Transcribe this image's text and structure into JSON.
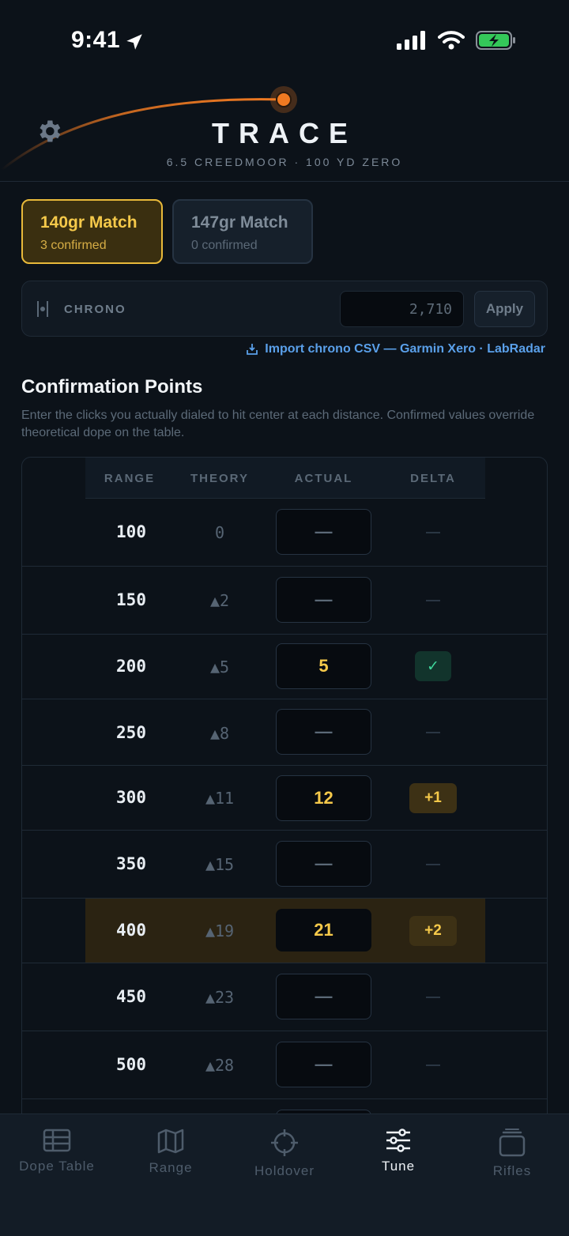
{
  "status": {
    "time": "9:41"
  },
  "header": {
    "title": "TRACE",
    "subtitle": "6.5 CREEDMOOR · 100 YD ZERO"
  },
  "loads": [
    {
      "name": "140gr Match",
      "confirmed": "3 confirmed",
      "active": true
    },
    {
      "name": "147gr Match",
      "confirmed": "0 confirmed",
      "active": false
    }
  ],
  "chrono": {
    "label": "CHRONO",
    "value": "2,710",
    "apply": "Apply"
  },
  "import_link": "Import chrono CSV — Garmin Xero · LabRadar",
  "section": {
    "title": "Confirmation Points",
    "description": "Enter the clicks you actually dialed to hit center at each distance. Confirmed values override theoretical dope on the table."
  },
  "table": {
    "headers": {
      "range": "RANGE",
      "theory": "THEORY",
      "actual": "ACTUAL",
      "delta": "DELTA"
    },
    "rows": [
      {
        "range": "100",
        "theory": "0",
        "actual": "—",
        "delta": ""
      },
      {
        "range": "150",
        "theory": "▲2",
        "actual": "—",
        "delta": ""
      },
      {
        "range": "200",
        "theory": "▲5",
        "actual": "5",
        "delta": "✓"
      },
      {
        "range": "250",
        "theory": "▲8",
        "actual": "—",
        "delta": ""
      },
      {
        "range": "300",
        "theory": "▲11",
        "actual": "12",
        "delta": "+1"
      },
      {
        "range": "350",
        "theory": "▲15",
        "actual": "—",
        "delta": ""
      },
      {
        "range": "400",
        "theory": "▲19",
        "actual": "21",
        "delta": "+2"
      },
      {
        "range": "450",
        "theory": "▲23",
        "actual": "—",
        "delta": ""
      },
      {
        "range": "500",
        "theory": "▲28",
        "actual": "—",
        "delta": ""
      }
    ]
  },
  "tabs": [
    {
      "label": "Dope Table",
      "icon": "table-icon"
    },
    {
      "label": "Range",
      "icon": "map-icon"
    },
    {
      "label": "Holdover",
      "icon": "crosshair-icon"
    },
    {
      "label": "Tune",
      "icon": "sliders-icon",
      "active": true
    },
    {
      "label": "Rifles",
      "icon": "stack-icon"
    }
  ],
  "colors": {
    "accent": "#f5c94a",
    "link": "#5aa0ea",
    "success": "#3fd59a",
    "trace": "#f07a22"
  }
}
